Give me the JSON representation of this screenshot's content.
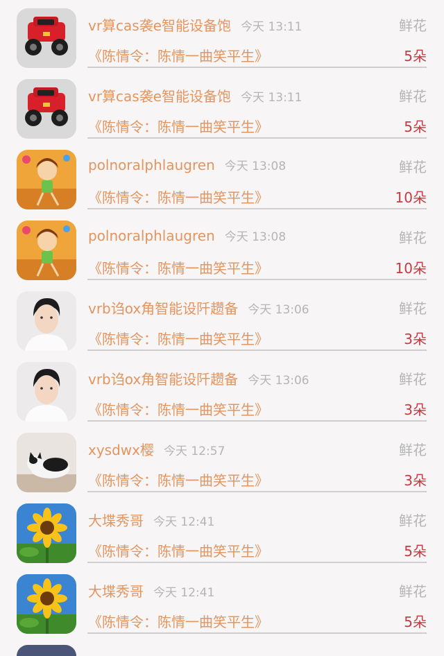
{
  "gift_list": {
    "items": [
      {
        "name": "vr算cas袭e智能设备饱",
        "time": "今天 13:11",
        "gift_type": "鲜花",
        "song": "《陈情令：陈情一曲笑平生》",
        "count": "5朵",
        "avatar": "car-avatar"
      },
      {
        "name": "vr算cas袭e智能设备饱",
        "time": "今天 13:11",
        "gift_type": "鲜花",
        "song": "《陈情令：陈情一曲笑平生》",
        "count": "5朵",
        "avatar": "car-avatar"
      },
      {
        "name": "polnoralphlaugren",
        "time": "今天 13:08",
        "gift_type": "鲜花",
        "song": "《陈情令：陈情一曲笑平生》",
        "count": "10朵",
        "avatar": "cartoon-girl-avatar"
      },
      {
        "name": "polnoralphlaugren",
        "time": "今天 13:08",
        "gift_type": "鲜花",
        "song": "《陈情令：陈情一曲笑平生》",
        "count": "10朵",
        "avatar": "cartoon-girl-avatar"
      },
      {
        "name": "vrb诌ox角智能设阡趱备",
        "time": "今天 13:06",
        "gift_type": "鲜花",
        "song": "《陈情令：陈情一曲笑平生》",
        "count": "3朵",
        "avatar": "boy-portrait-avatar"
      },
      {
        "name": "vrb诌ox角智能设阡趱备",
        "time": "今天 13:06",
        "gift_type": "鲜花",
        "song": "《陈情令：陈情一曲笑平生》",
        "count": "3朵",
        "avatar": "boy-portrait-avatar"
      },
      {
        "name": "xysdwx樱",
        "time": "今天 12:57",
        "gift_type": "鲜花",
        "song": "《陈情令：陈情一曲笑平生》",
        "count": "3朵",
        "avatar": "cat-avatar"
      },
      {
        "name": "大堞秀哥",
        "time": "今天 12:41",
        "gift_type": "鲜花",
        "song": "《陈情令：陈情一曲笑平生》",
        "count": "5朵",
        "avatar": "sunflower-avatar"
      },
      {
        "name": "大堞秀哥",
        "time": "今天 12:41",
        "gift_type": "鲜花",
        "song": "《陈情令：陈情一曲笑平生》",
        "count": "5朵",
        "avatar": "sunflower-avatar"
      }
    ]
  },
  "colors": {
    "name": "#e39560",
    "time": "#b5b5b5",
    "gift_type": "#b4b4b4",
    "count": "#c73a42",
    "divider": "#cfcfcf",
    "background": "#f7f5f5"
  }
}
